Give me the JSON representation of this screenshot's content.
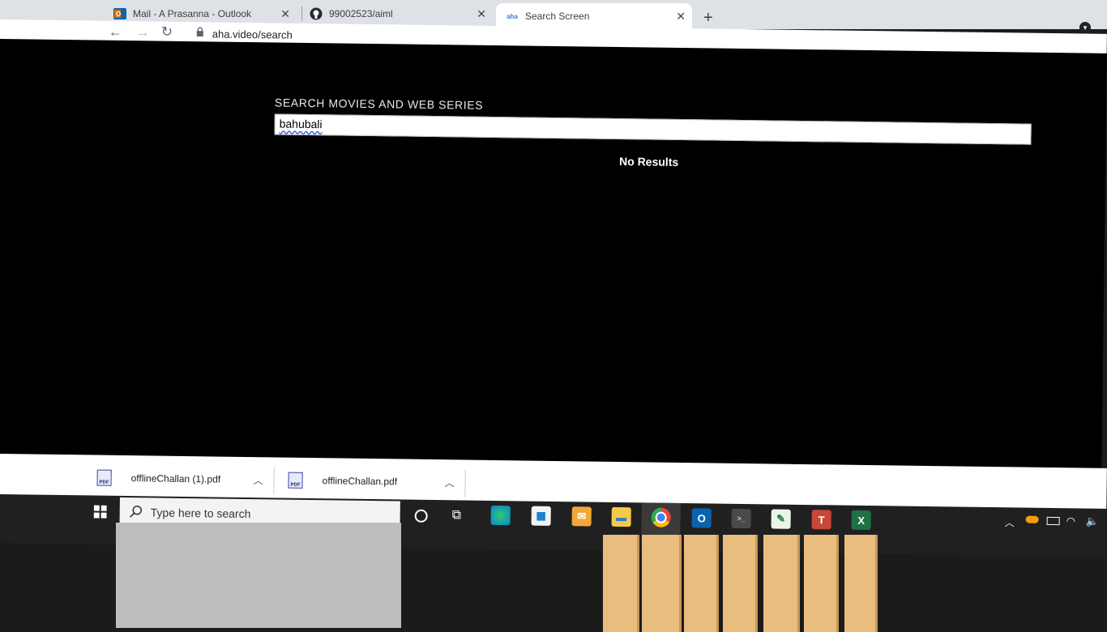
{
  "tabs": [
    {
      "title": "Mail - A Prasanna - Outlook",
      "icon": "outlook-icon"
    },
    {
      "title": "99002523/aiml",
      "icon": "github-icon"
    },
    {
      "title": "Search Screen",
      "icon": "aha-icon",
      "favicon_text": "aha"
    }
  ],
  "new_tab": "+",
  "profile_menu": "▾",
  "address": {
    "url": "aha.video/search"
  },
  "content": {
    "heading": "SEARCH MOVIES AND WEB SERIES",
    "query": "bahubali",
    "no_results": "No Results"
  },
  "downloads": [
    {
      "name": "offlineChallan (1).pdf",
      "icon_label": "PDF"
    },
    {
      "name": "offlineChallan.pdf",
      "icon_label": "PDF"
    }
  ],
  "taskbar": {
    "search_placeholder": "Type here to search",
    "apps": [
      "edge-icon",
      "store-icon",
      "mail-icon",
      "file-explorer-icon",
      "chrome-icon",
      "outlook-icon",
      "terminal-icon",
      "notepad-icon",
      "teams-icon",
      "excel-icon"
    ]
  },
  "colors": {
    "page_bg": "#000000",
    "chrome_tab": "#dee1e6",
    "accent": "#3b5bdb"
  }
}
